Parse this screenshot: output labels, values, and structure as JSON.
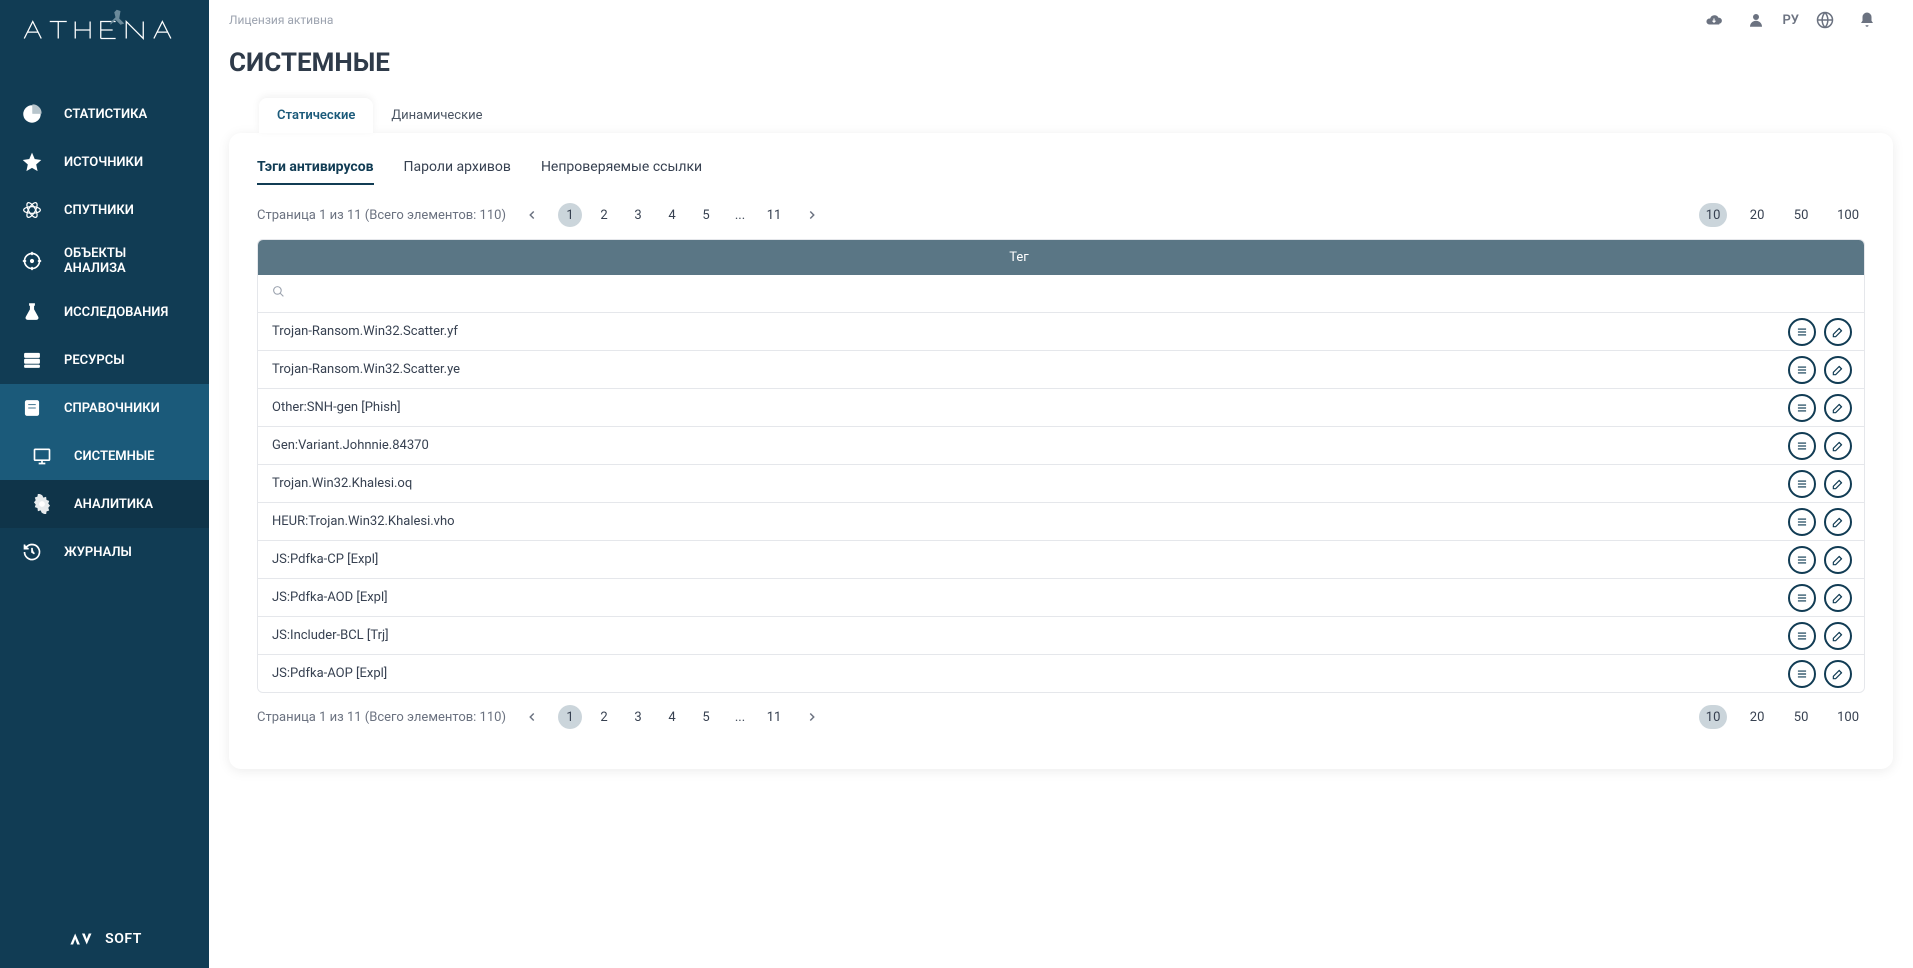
{
  "app": {
    "license_status": "Лицензия активна",
    "lang_label": "РУ"
  },
  "page": {
    "title": "СИСТЕМНЫЕ"
  },
  "sidebar": {
    "footer_label": "SOFT",
    "items": [
      {
        "label": "СТАТИСТИКА"
      },
      {
        "label": "ИСТОЧНИКИ"
      },
      {
        "label": "СПУТНИКИ"
      },
      {
        "label": "ОБЪЕКТЫ АНАЛИЗА"
      },
      {
        "label": "ИССЛЕДОВАНИЯ"
      },
      {
        "label": "РЕСУРСЫ"
      },
      {
        "label": "СПРАВОЧНИКИ"
      },
      {
        "label": "СИСТЕМНЫЕ"
      },
      {
        "label": "АНАЛИТИКА"
      },
      {
        "label": "ЖУРНАЛЫ"
      }
    ]
  },
  "outer_tabs": [
    {
      "label": "Статические"
    },
    {
      "label": "Динамические"
    }
  ],
  "inner_tabs": [
    {
      "label": "Тэги антивирусов"
    },
    {
      "label": "Пароли архивов"
    },
    {
      "label": "Непроверяемые ссылки"
    }
  ],
  "pagination": {
    "info": "Страница 1 из 11 (Всего элементов: 110)",
    "current_page": "1",
    "pages": [
      "1",
      "2",
      "3",
      "4",
      "5",
      "...",
      "11"
    ],
    "sizes": [
      "10",
      "20",
      "50",
      "100"
    ],
    "current_size": "10"
  },
  "table": {
    "header": "Тег",
    "rows": [
      {
        "tag": "Trojan-Ransom.Win32.Scatter.yf"
      },
      {
        "tag": "Trojan-Ransom.Win32.Scatter.ye"
      },
      {
        "tag": "Other:SNH-gen [Phish]"
      },
      {
        "tag": "Gen:Variant.Johnnie.84370"
      },
      {
        "tag": "Trojan.Win32.Khalesi.oq"
      },
      {
        "tag": "HEUR:Trojan.Win32.Khalesi.vho"
      },
      {
        "tag": "JS:Pdfka-CP [Expl]"
      },
      {
        "tag": "JS:Pdfka-AOD [Expl]"
      },
      {
        "tag": "JS:Includer-BCL [Trj]"
      },
      {
        "tag": "JS:Pdfka-AOP [Expl]"
      }
    ]
  }
}
